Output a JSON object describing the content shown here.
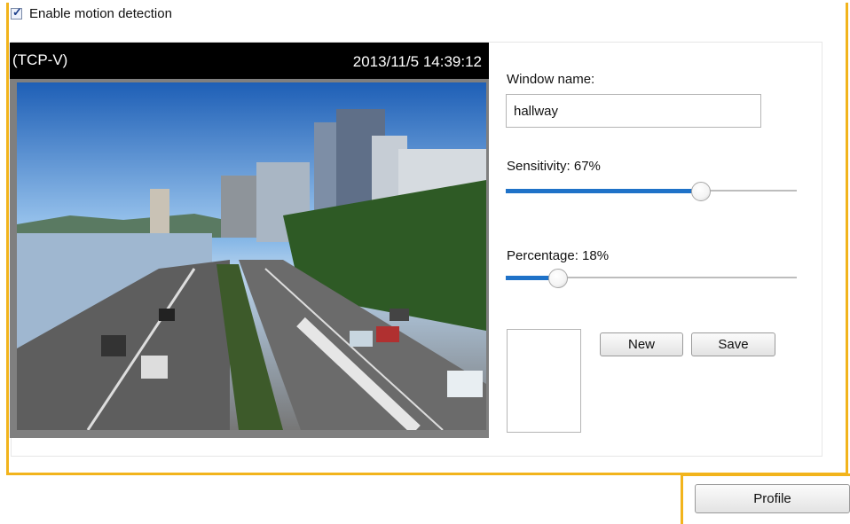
{
  "motion": {
    "enable_label": "Enable motion detection",
    "enabled": true
  },
  "video": {
    "tag": "(TCP-V)",
    "timestamp": "2013/11/5 14:39:12"
  },
  "window_name": {
    "label": "Window name:",
    "value": "hallway"
  },
  "sensitivity": {
    "label": "Sensitivity: 67%",
    "value": 67
  },
  "percentage": {
    "label": "Percentage: 18%",
    "value": 18
  },
  "buttons": {
    "new_label": "New",
    "save_label": "Save",
    "profile_label": "Profile"
  },
  "colors": {
    "highlight": "#f2b41c",
    "slider_fill": "#1f72c8"
  }
}
